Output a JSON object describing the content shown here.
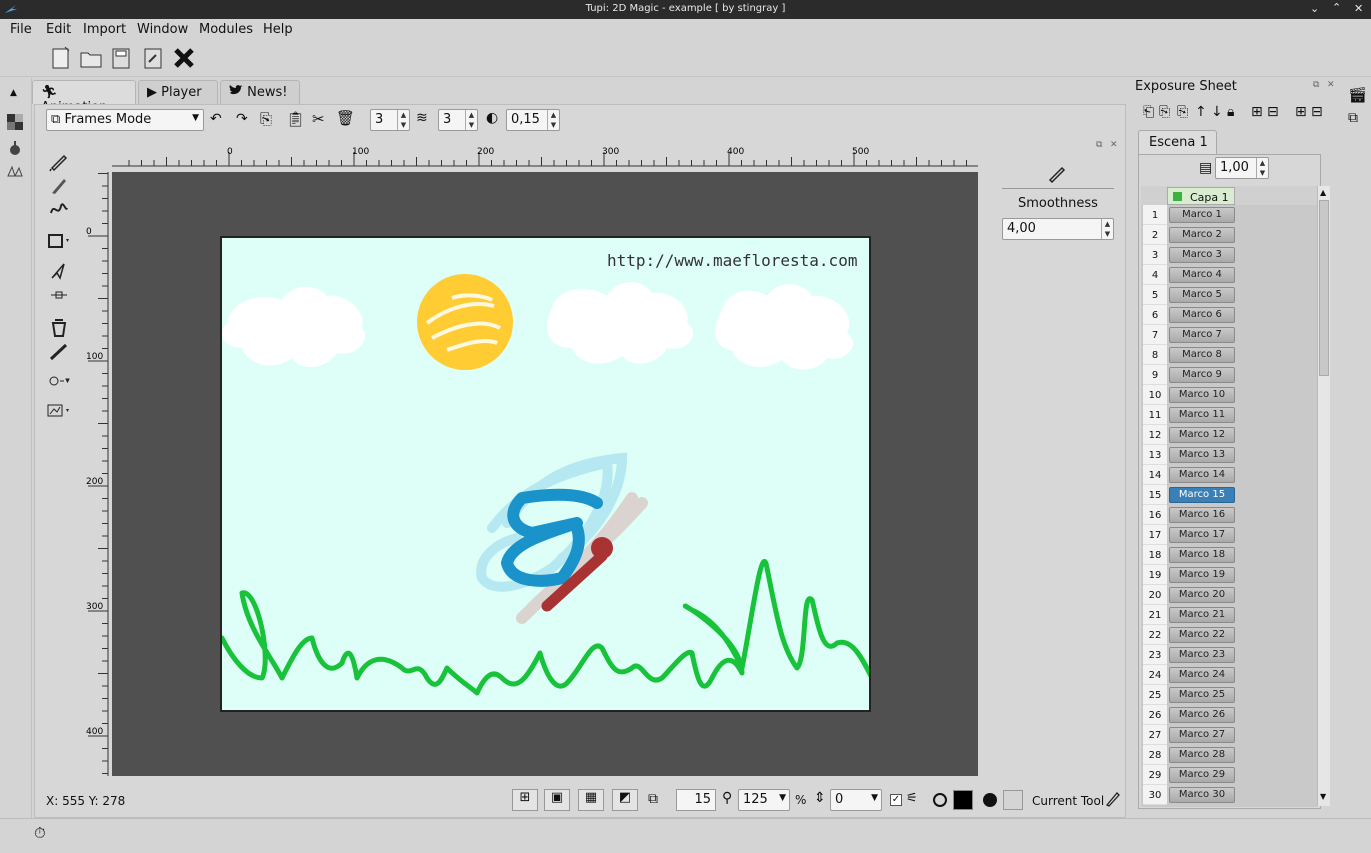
{
  "window": {
    "title": "Tupi: 2D Magic - example [ by stingray ]"
  },
  "menu": [
    "File",
    "Edit",
    "Import",
    "Window",
    "Modules",
    "Help"
  ],
  "tabs": [
    {
      "label": "Animation",
      "icon": "running-figure-icon"
    },
    {
      "label": "Player",
      "icon": "play-icon"
    },
    {
      "label": "News!",
      "icon": "twitter-bird-icon"
    }
  ],
  "paint_toolbar": {
    "mode": "Frames Mode",
    "onion_previous": "3",
    "onion_next": "3",
    "opacity": "0,15"
  },
  "ruler_top": [
    "0",
    "100",
    "200",
    "300",
    "400",
    "500"
  ],
  "ruler_left": [
    "0",
    "100",
    "200",
    "300",
    "400"
  ],
  "canvas": {
    "url_text": "http://www.maefloresta.com"
  },
  "tool_settings": {
    "title": "Smoothness",
    "value": "4,00"
  },
  "status": {
    "coords": "X: 555 Y: 278",
    "frame": "15",
    "zoom": "125",
    "percent": "%",
    "rotation": "0",
    "current_tool_label": "Current Tool"
  },
  "exposure": {
    "title": "Exposure Sheet",
    "scene_tab": "Escena 1",
    "fps": "1,00",
    "layer": "Capa 1",
    "layer_color": "#3cb043",
    "selected_frame": 15,
    "frames": [
      {
        "n": "1",
        "name": "Marco 1"
      },
      {
        "n": "2",
        "name": "Marco 2"
      },
      {
        "n": "3",
        "name": "Marco 3"
      },
      {
        "n": "4",
        "name": "Marco 4"
      },
      {
        "n": "5",
        "name": "Marco 5"
      },
      {
        "n": "6",
        "name": "Marco 6"
      },
      {
        "n": "7",
        "name": "Marco 7"
      },
      {
        "n": "8",
        "name": "Marco 8"
      },
      {
        "n": "9",
        "name": "Marco 9"
      },
      {
        "n": "10",
        "name": "Marco 10"
      },
      {
        "n": "11",
        "name": "Marco 11"
      },
      {
        "n": "12",
        "name": "Marco 12"
      },
      {
        "n": "13",
        "name": "Marco 13"
      },
      {
        "n": "14",
        "name": "Marco 14"
      },
      {
        "n": "15",
        "name": "Marco 15"
      },
      {
        "n": "16",
        "name": "Marco 16"
      },
      {
        "n": "17",
        "name": "Marco 17"
      },
      {
        "n": "18",
        "name": "Marco 18"
      },
      {
        "n": "19",
        "name": "Marco 19"
      },
      {
        "n": "20",
        "name": "Marco 20"
      },
      {
        "n": "21",
        "name": "Marco 21"
      },
      {
        "n": "22",
        "name": "Marco 22"
      },
      {
        "n": "23",
        "name": "Marco 23"
      },
      {
        "n": "24",
        "name": "Marco 24"
      },
      {
        "n": "25",
        "name": "Marco 25"
      },
      {
        "n": "26",
        "name": "Marco 26"
      },
      {
        "n": "27",
        "name": "Marco 27"
      },
      {
        "n": "28",
        "name": "Marco 28"
      },
      {
        "n": "29",
        "name": "Marco 29"
      },
      {
        "n": "30",
        "name": "Marco 30"
      }
    ]
  },
  "colors": {
    "selection": "#3a7fb5",
    "canvas_bg": "#ddfff7",
    "stage_bg": "#505050"
  }
}
